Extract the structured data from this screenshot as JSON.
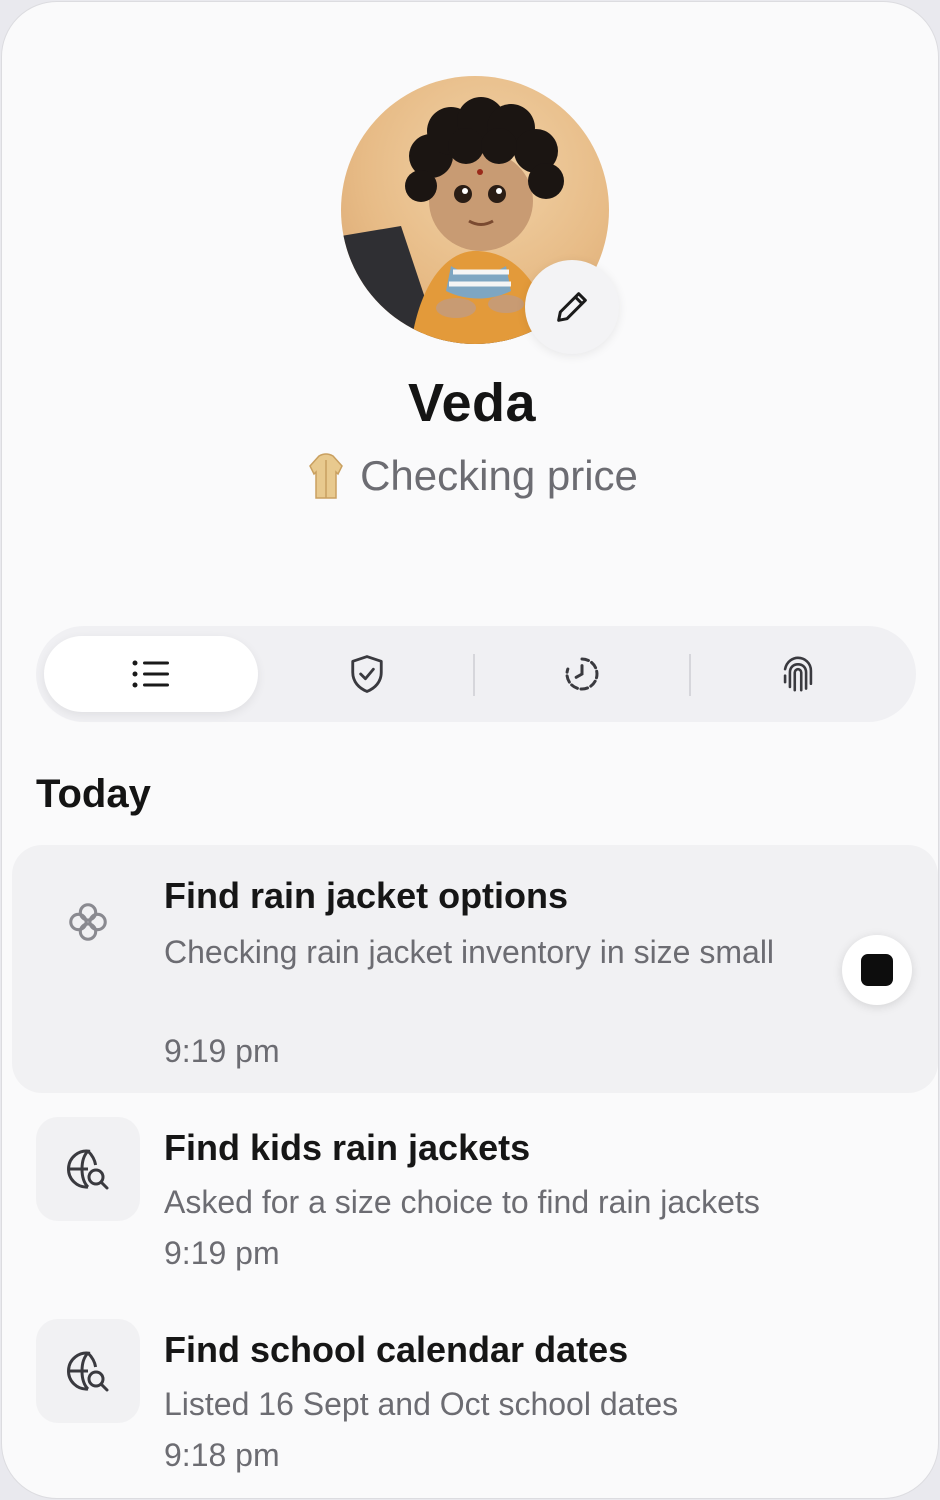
{
  "agent": {
    "name": "Veda",
    "status_text": "Checking price",
    "status_icon": "raincoat-icon",
    "avatar_icon": "avatar-image"
  },
  "tabs": [
    {
      "icon": "list-icon",
      "active": true
    },
    {
      "icon": "shield-check-icon",
      "active": false
    },
    {
      "icon": "clock-history-icon",
      "active": false
    },
    {
      "icon": "fingerprint-icon",
      "active": false
    }
  ],
  "section": {
    "title": "Today"
  },
  "tasks": [
    {
      "title": "Find rain jacket options",
      "description": "Checking rain jacket inventory in size small",
      "time": "9:19 pm",
      "icon": "spinner-flower-icon",
      "in_progress": true
    },
    {
      "title": "Find kids rain jackets",
      "description": "Asked for a size choice to find rain jackets",
      "time": "9:19 pm",
      "icon": "globe-search-icon"
    },
    {
      "title": "Find school calendar dates",
      "description": "Listed 16 Sept and Oct school dates",
      "time": "9:18 pm",
      "icon": "globe-search-icon"
    }
  ]
}
